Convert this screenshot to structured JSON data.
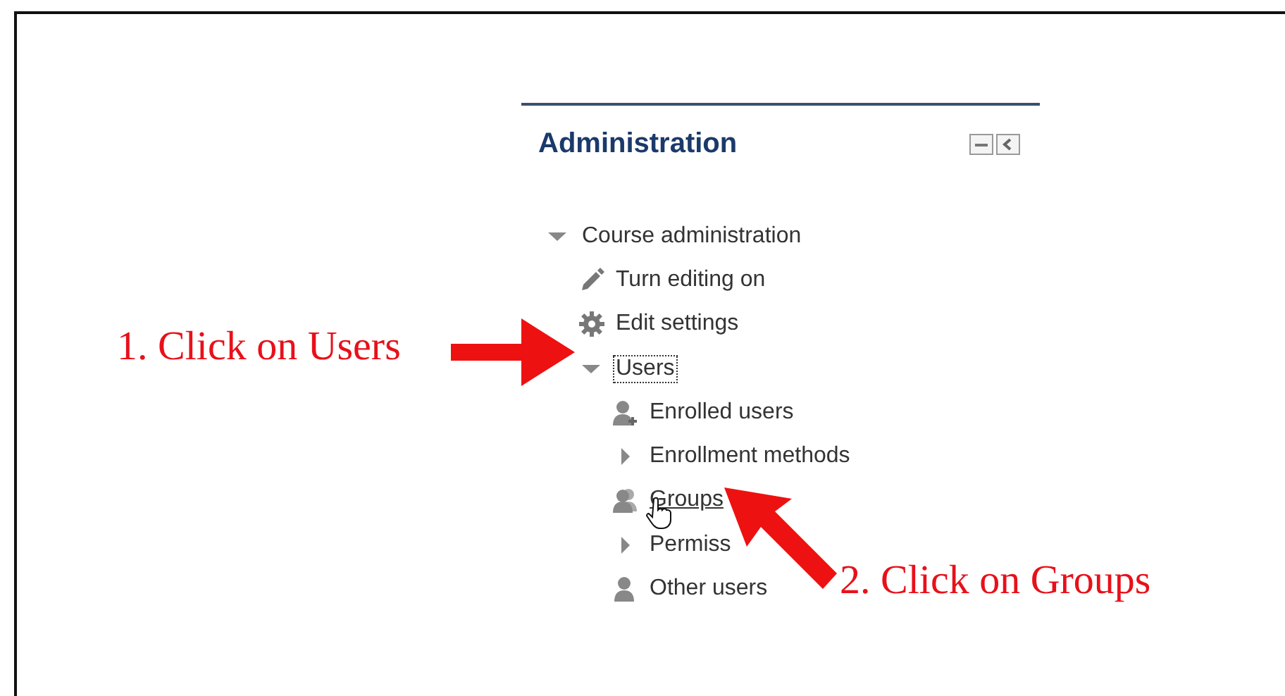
{
  "block": {
    "title": "Administration",
    "tree": [
      {
        "label": "Course administration",
        "kind": "branch",
        "expanded": true,
        "focused": false,
        "hovered": false,
        "children": [
          {
            "label": "Turn editing on",
            "kind": "pencil",
            "focused": false,
            "hovered": false
          },
          {
            "label": "Edit settings",
            "kind": "gear",
            "focused": false,
            "hovered": false
          },
          {
            "label": "Users",
            "kind": "branch",
            "expanded": true,
            "focused": true,
            "hovered": false,
            "children": [
              {
                "label": "Enrolled users",
                "kind": "user-add",
                "focused": false,
                "hovered": false
              },
              {
                "label": "Enrollment methods",
                "kind": "branch",
                "expanded": false,
                "focused": false,
                "hovered": false
              },
              {
                "label": "Groups",
                "kind": "groups",
                "focused": false,
                "hovered": true
              },
              {
                "label": "Permiss",
                "kind": "branch",
                "expanded": false,
                "focused": false,
                "hovered": false
              },
              {
                "label": "Other users",
                "kind": "user",
                "focused": false,
                "hovered": false
              }
            ]
          }
        ]
      }
    ]
  },
  "annotations": [
    {
      "text": "1. Click on Users",
      "kind": "right"
    },
    {
      "text": "2. Click on Groups",
      "kind": "up-left"
    }
  ]
}
